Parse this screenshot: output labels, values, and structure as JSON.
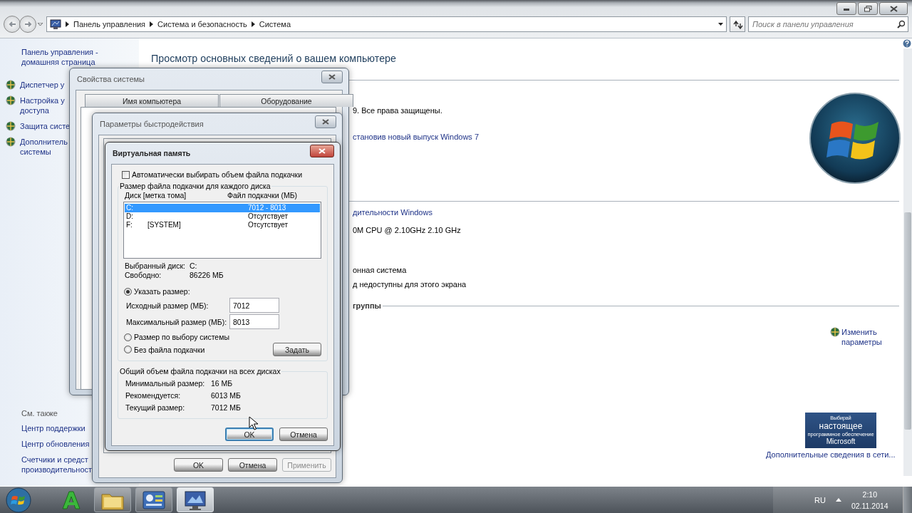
{
  "explorer": {
    "breadcrumb": [
      "Панель управления",
      "Система и безопасность",
      "Система"
    ],
    "search": {
      "placeholder": "Поиск в панели управления"
    },
    "sidebar": {
      "home": "Панель управления -\nдомашняя страница",
      "tasks": [
        "Диспетчер у",
        "Настройка у\nдоступа",
        "Защита систе",
        "Дополнитель\nсистемы"
      ],
      "see_also": {
        "title": "См. также",
        "links": [
          "Центр поддержки",
          "Центр обновления",
          "Счетчики и средст\nпроизводительност"
        ]
      }
    },
    "main": {
      "heading": "Просмотр основных сведений о вашем компьютере",
      "lines": [
        {
          "kind": "text",
          "text": "9. Все права защищены."
        },
        {
          "kind": "link",
          "text": "становив новый выпуск Windows 7"
        },
        {
          "kind": "link",
          "text": "дительности Windows"
        },
        {
          "kind": "text",
          "text": "0M CPU @ 2.10GHz  2.10 GHz"
        },
        {
          "kind": "text",
          "text": "онная система"
        },
        {
          "kind": "text",
          "text": "д недоступны для этого экрана"
        },
        {
          "kind": "group",
          "text": "группы"
        }
      ],
      "change_settings": "Изменить\nпараметры",
      "badge": [
        "Выбирай",
        "настоящее",
        "программное обеспечение",
        "Microsoft"
      ],
      "more_info": "Дополнительные сведения в сети..."
    }
  },
  "dialogs": {
    "system_properties": {
      "title": "Свойства системы",
      "tabs": [
        {
          "label": "Имя компьютера",
          "selected": false
        },
        {
          "label": "Оборудование",
          "selected": false
        }
      ]
    },
    "performance": {
      "title": "Параметры быстродействия",
      "buttons": [
        {
          "label": "OK",
          "disabled": false
        },
        {
          "label": "Отмена",
          "disabled": false
        },
        {
          "label": "Применить",
          "disabled": true
        }
      ]
    },
    "virtual_memory": {
      "title": "Виртуальная память",
      "auto_manage": {
        "label": "Автоматически выбирать объем файла подкачки",
        "checked": false
      },
      "drives_group": "Размер файла подкачки для каждого диска",
      "columns": [
        "Диск [метка тома]",
        "Файл подкачки (МБ)"
      ],
      "drives": [
        {
          "drive": "C:",
          "paging": "7012 - 8013",
          "selected": true
        },
        {
          "drive": "D:",
          "paging": "Отсутствует",
          "selected": false
        },
        {
          "drive": "F:",
          "label": "[SYSTEM]",
          "paging": "Отсутствует",
          "selected": false
        }
      ],
      "selected_drive": {
        "label": "Выбранный диск:",
        "value": "C:"
      },
      "free_space": {
        "label": "Свободно:",
        "value": "86226 МБ"
      },
      "options": [
        {
          "kind": "custom",
          "label": "Указать размер:",
          "selected": true
        },
        {
          "kind": "system",
          "label": "Размер по выбору системы",
          "selected": false
        },
        {
          "kind": "none",
          "label": "Без файла подкачки",
          "selected": false
        }
      ],
      "initial_size": {
        "label": "Исходный размер (МБ):",
        "value": "7012"
      },
      "maximum_size": {
        "label": "Максимальный размер (МБ):",
        "value": "8013"
      },
      "set_button": "Задать",
      "totals_group": "Общий объем файла подкачки на всех дисках",
      "totals": [
        {
          "label": "Минимальный размер:",
          "value": "16 МБ"
        },
        {
          "label": "Рекомендуется:",
          "value": "6013 МБ"
        },
        {
          "label": "Текущий размер:",
          "value": "7012 МБ"
        }
      ],
      "buttons": [
        {
          "label": "OK",
          "default": true
        },
        {
          "label": "Отмена",
          "default": false
        }
      ]
    }
  },
  "taskbar": {
    "apps": [
      {
        "kind": "letter-app",
        "running": false,
        "selected": false
      },
      {
        "kind": "folder",
        "running": true,
        "selected": false
      },
      {
        "kind": "control-panel",
        "running": true,
        "selected": false
      },
      {
        "kind": "monitor",
        "running": true,
        "selected": true
      }
    ],
    "language": "RU",
    "time": "2:10",
    "date": "02.11.2014"
  }
}
